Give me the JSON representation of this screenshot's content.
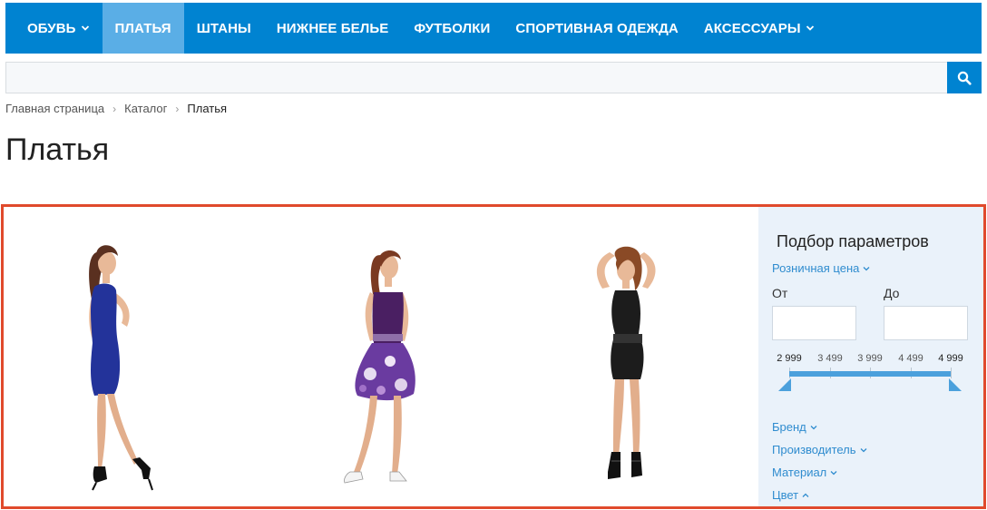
{
  "nav": {
    "items": [
      {
        "label": "ОБУВЬ",
        "has_dropdown": true,
        "active": false
      },
      {
        "label": "ПЛАТЬЯ",
        "has_dropdown": false,
        "active": true
      },
      {
        "label": "ШТАНЫ",
        "has_dropdown": false,
        "active": false
      },
      {
        "label": "НИЖНЕЕ БЕЛЬЕ",
        "has_dropdown": false,
        "active": false
      },
      {
        "label": "ФУТБОЛКИ",
        "has_dropdown": false,
        "active": false
      },
      {
        "label": "СПОРТИВНАЯ ОДЕЖДА",
        "has_dropdown": false,
        "active": false
      },
      {
        "label": "АКСЕССУАРЫ",
        "has_dropdown": true,
        "active": false
      }
    ]
  },
  "search": {
    "value": "",
    "placeholder": "",
    "button_icon": "search-icon"
  },
  "breadcrumb": {
    "items": [
      "Главная страница",
      "Каталог",
      "Платья"
    ]
  },
  "page": {
    "title": "Платья"
  },
  "products": [
    {
      "image": "woman-blue-dress",
      "dress_color": "#23339a"
    },
    {
      "image": "woman-purple-floral-dress",
      "dress_color": "#5a2a78"
    },
    {
      "image": "woman-black-dress",
      "dress_color": "#1c1c1c"
    }
  ],
  "filter": {
    "title": "Подбор параметров",
    "price": {
      "label": "Розничная цена",
      "from_label": "От",
      "to_label": "До",
      "from_value": "",
      "to_value": "",
      "ticks": [
        "2 999",
        "3 499",
        "3 999",
        "4 499",
        "4 999"
      ]
    },
    "sections": [
      {
        "label": "Бренд",
        "expanded": false
      },
      {
        "label": "Производитель",
        "expanded": false
      },
      {
        "label": "Материал",
        "expanded": false
      },
      {
        "label": "Цвет",
        "expanded": true
      }
    ]
  },
  "colors": {
    "brand_blue": "#0083d1",
    "active_nav": "#5aaee6",
    "link_blue": "#2f8ccf",
    "filter_bg": "#eaf2fa",
    "highlight_red": "#e04a2c"
  }
}
